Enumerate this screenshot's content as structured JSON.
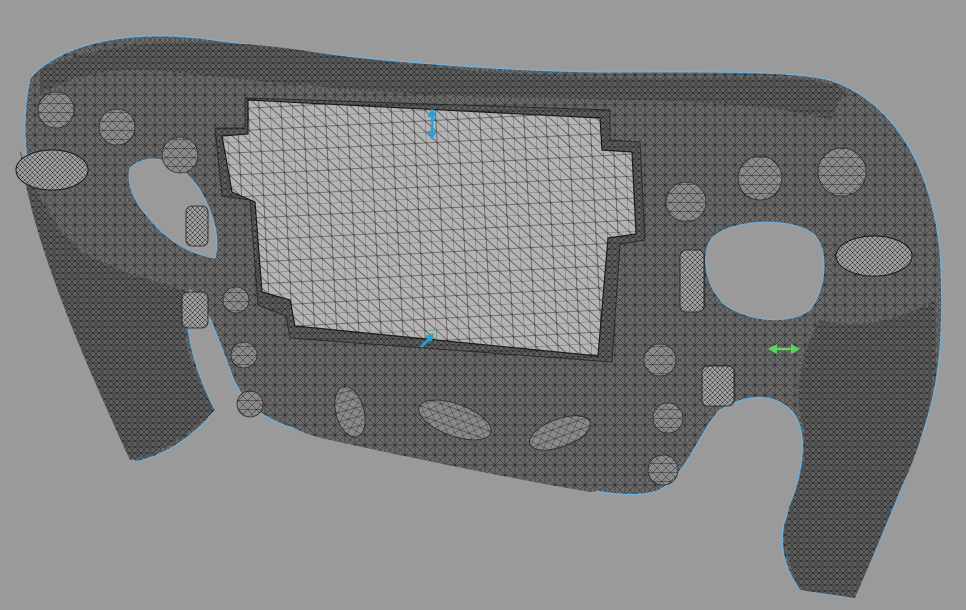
{
  "viewport": {
    "background_color": "#9a9a9a"
  },
  "model": {
    "mesh_fill_color": "#6e6e6e",
    "mesh_line_color": "#1a1a1a",
    "display_fill_color": "#b8b8b8",
    "outline_color": "#6fb3e0"
  },
  "annotations": [
    {
      "type": "vertical-arrow-icon",
      "color": "#2a9fd8"
    },
    {
      "type": "diagonal-arrow-icon",
      "color": "#2a9fd8"
    },
    {
      "type": "horizontal-arrow-icon",
      "color": "#5bd65b"
    }
  ]
}
